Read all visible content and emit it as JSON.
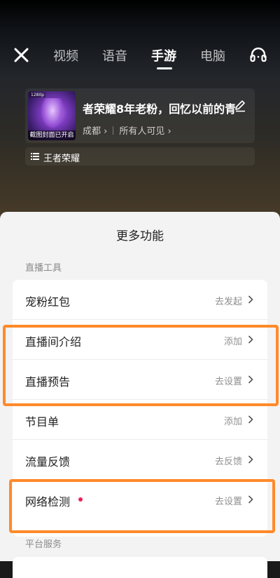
{
  "header": {
    "tabs": [
      {
        "label": "视频",
        "active": false
      },
      {
        "label": "语音",
        "active": false
      },
      {
        "label": "手游",
        "active": true
      },
      {
        "label": "电脑",
        "active": false
      }
    ]
  },
  "room": {
    "title": "者荣耀8年老粉，回忆以前的青",
    "cover_caption": "截图封面已开启",
    "cover_tag": "1280p",
    "location": "成都",
    "visibility": "所有人可见",
    "category": "王者荣耀"
  },
  "sheet": {
    "title": "更多功能",
    "section_live_tools": "直播工具",
    "section_platform": "平台服务",
    "items": [
      {
        "label": "宠粉红包",
        "action": "去发起",
        "dot": false
      },
      {
        "label": "直播间介绍",
        "action": "添加",
        "dot": false
      },
      {
        "label": "直播预告",
        "action": "去设置",
        "dot": false
      },
      {
        "label": "节目单",
        "action": "添加",
        "dot": false
      },
      {
        "label": "流量反馈",
        "action": "去反馈",
        "dot": false
      },
      {
        "label": "网络检测",
        "action": "去设置",
        "dot": true
      }
    ]
  },
  "colors": {
    "highlight": "#ff8a2a",
    "notify_dot": "#f0205a"
  }
}
